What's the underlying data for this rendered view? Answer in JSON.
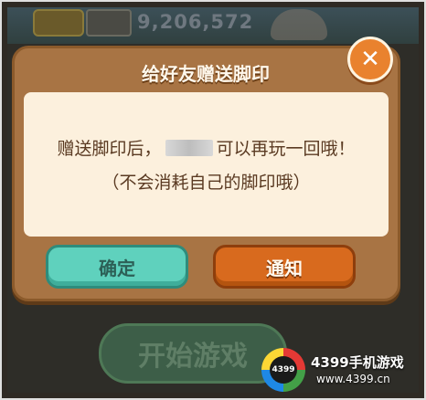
{
  "background": {
    "score": "9,206,572",
    "start_button_label": "开始游戏"
  },
  "dialog": {
    "title": "给好友赠送脚印",
    "message_line1_prefix": "赠送脚印后，",
    "message_line1_suffix": "可以再玩一回哦！",
    "message_line2": "（不会消耗自己的脚印哦）",
    "close_symbol": "✕",
    "confirm_label": "确定",
    "notify_label": "通知"
  },
  "watermark": {
    "logo_text": "4399",
    "title": "4399手机游戏",
    "url": "www.4399.cn"
  },
  "colors": {
    "dialog_frame": "#a87444",
    "dialog_body": "#fcf0dd",
    "confirm_button": "#5fd1bd",
    "notify_button": "#d86a1e",
    "close_button": "#e9822e"
  }
}
